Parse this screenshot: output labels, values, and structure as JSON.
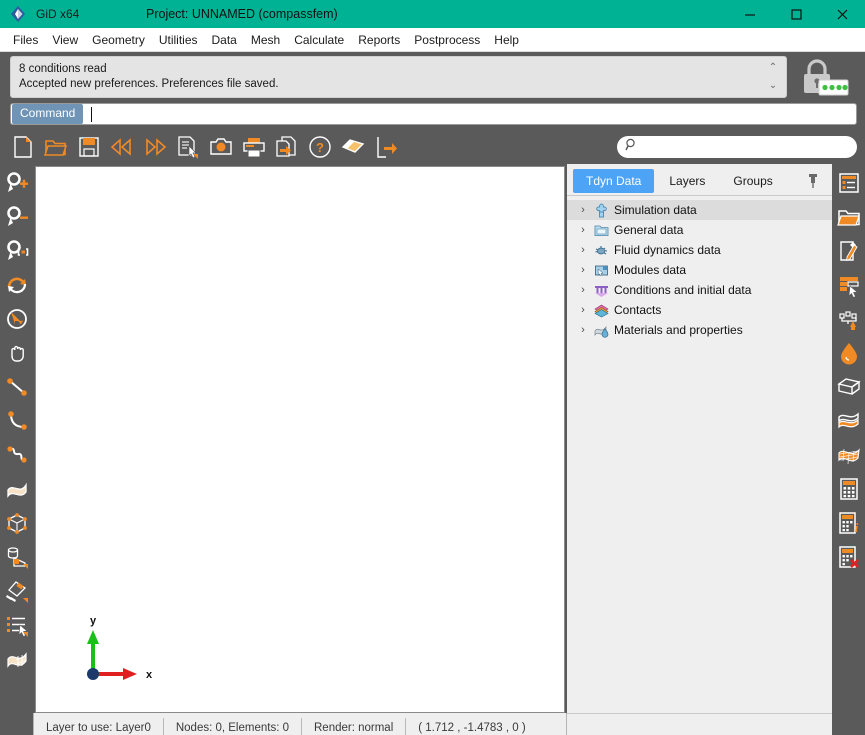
{
  "window": {
    "app_name": "GiD x64",
    "project_title": "Project: UNNAMED (compassfem)",
    "logo_color": "#2b5c9e",
    "titlebar_color": "#00b294",
    "minimize_label": "—",
    "maximize_label": "☐",
    "close_label": "✕"
  },
  "menubar": {
    "items": [
      {
        "label": "Files"
      },
      {
        "label": "View"
      },
      {
        "label": "Geometry"
      },
      {
        "label": "Utilities"
      },
      {
        "label": "Data"
      },
      {
        "label": "Mesh"
      },
      {
        "label": "Calculate"
      },
      {
        "label": "Reports"
      },
      {
        "label": "Postprocess"
      },
      {
        "label": "Help"
      }
    ]
  },
  "messages": {
    "line1": "8 conditions read",
    "line2": "Accepted new preferences. Preferences file saved.",
    "scroll_up": "⌃",
    "scroll_down": "⌄",
    "lock_icon": "padlock-icon",
    "lock_dots": 4,
    "lock_dot_color": "#3fbf3f"
  },
  "command": {
    "label": "Command",
    "value": "",
    "placeholder": ""
  },
  "toolbar": {
    "items": [
      {
        "name": "new-file-button",
        "icon": "new-document-icon",
        "tooltip": "New"
      },
      {
        "name": "open-file-button",
        "icon": "open-folder-icon",
        "tooltip": "Open"
      },
      {
        "name": "save-file-button",
        "icon": "save-floppy-icon",
        "tooltip": "Save"
      },
      {
        "name": "undo-button",
        "icon": "undo-double-left-icon",
        "tooltip": "Undo"
      },
      {
        "name": "redo-button",
        "icon": "redo-double-right-icon",
        "tooltip": "Redo"
      },
      {
        "name": "select-list-button",
        "icon": "document-cursor-icon",
        "tooltip": "Select"
      },
      {
        "name": "snapshot-button",
        "icon": "camera-icon",
        "tooltip": "Image capture"
      },
      {
        "name": "print-button",
        "icon": "printer-icon",
        "tooltip": "Print"
      },
      {
        "name": "export-button",
        "icon": "document-export-icon",
        "tooltip": "Export"
      },
      {
        "name": "help-button",
        "icon": "question-mark-icon",
        "tooltip": "Help"
      },
      {
        "name": "layers-button",
        "icon": "layer-diamond-icon",
        "tooltip": "Layers"
      },
      {
        "name": "exit-button",
        "icon": "exit-arrow-icon",
        "tooltip": "Quit"
      }
    ]
  },
  "search": {
    "value": "",
    "placeholder": "",
    "icon": "search-icon"
  },
  "left_toolbar": {
    "items": [
      {
        "name": "zoom-in-tool",
        "icon": "zoom-in-icon"
      },
      {
        "name": "zoom-out-tool",
        "icon": "zoom-out-icon"
      },
      {
        "name": "zoom-frame-tool",
        "icon": "zoom-frame-icon"
      },
      {
        "name": "rotate-tool",
        "icon": "rotate-icon"
      },
      {
        "name": "rotate-trackball-tool",
        "icon": "rotate-trackball-icon"
      },
      {
        "name": "pan-tool",
        "icon": "hand-pan-icon"
      },
      {
        "name": "create-line-tool",
        "icon": "line-icon"
      },
      {
        "name": "create-arc-tool",
        "icon": "arc-icon"
      },
      {
        "name": "create-nurbs-line-tool",
        "icon": "nurbs-curve-icon"
      },
      {
        "name": "create-surface-tool",
        "icon": "surface-icon"
      },
      {
        "name": "create-volume-tool",
        "icon": "volume-cube-icon"
      },
      {
        "name": "create-object-tool",
        "icon": "cylinder-object-icon"
      },
      {
        "name": "mesh-tool",
        "icon": "mesh-eraser-icon"
      },
      {
        "name": "list-select-tool",
        "icon": "list-cursor-icon"
      },
      {
        "name": "render-tool",
        "icon": "render-surface-icon"
      }
    ]
  },
  "right_toolbar": {
    "items": [
      {
        "name": "tree-panel-toggle",
        "icon": "tree-list-icon"
      },
      {
        "name": "open-project-button",
        "icon": "folder-open-icon"
      },
      {
        "name": "edit-data-button",
        "icon": "edit-pencil-icon"
      },
      {
        "name": "table-select-button",
        "icon": "table-cursor-icon"
      },
      {
        "name": "boundary-conditions-button",
        "icon": "conditions-icon"
      },
      {
        "name": "materials-button",
        "icon": "fluid-drop-icon"
      },
      {
        "name": "volume-view-button",
        "icon": "cube-outline-icon"
      },
      {
        "name": "surface-view-button",
        "icon": "surface-layers-icon"
      },
      {
        "name": "mesh-view-button",
        "icon": "mesh-patch-icon"
      },
      {
        "name": "calculate-button",
        "icon": "calculator-icon"
      },
      {
        "name": "calculate-info-button",
        "icon": "calculator-info-icon"
      },
      {
        "name": "cancel-process-button",
        "icon": "calculator-cancel-icon"
      }
    ]
  },
  "right_panel": {
    "tabs": [
      {
        "label": "Tdyn Data",
        "active": true
      },
      {
        "label": "Layers",
        "active": false
      },
      {
        "label": "Groups",
        "active": false
      }
    ],
    "pin_icon": "pin-icon",
    "tree": [
      {
        "label": "Simulation data",
        "icon": "simulation-data-icon",
        "chevron": "›",
        "selected": true
      },
      {
        "label": "General data",
        "icon": "general-data-folder-icon",
        "chevron": "›",
        "selected": false
      },
      {
        "label": "Fluid dynamics data",
        "icon": "fluid-dynamics-icon",
        "chevron": "›",
        "selected": false
      },
      {
        "label": "Modules data",
        "icon": "modules-data-icon",
        "chevron": "›",
        "selected": false
      },
      {
        "label": "Conditions and initial data",
        "icon": "conditions-initial-data-icon",
        "chevron": "›",
        "selected": false
      },
      {
        "label": "Contacts",
        "icon": "contacts-layers-icon",
        "chevron": "›",
        "selected": false
      },
      {
        "label": "Materials and properties",
        "icon": "materials-properties-icon",
        "chevron": "›",
        "selected": false
      }
    ]
  },
  "canvas": {
    "background": "#ffffff",
    "axis": {
      "x_label": "x",
      "y_label": "y",
      "x_color": "#e02020",
      "y_color": "#18c018",
      "origin_color": "#1b3a6b"
    }
  },
  "statusbar": {
    "fields": [
      {
        "name": "layer-to-use",
        "text": "Layer to use: Layer0"
      },
      {
        "name": "nodes-elements-count",
        "text": "Nodes: 0, Elements: 0"
      },
      {
        "name": "render-mode",
        "text": "Render: normal"
      },
      {
        "name": "cursor-coordinates",
        "text": "( 1.712  , -1.4783 ,  0 )"
      }
    ]
  }
}
